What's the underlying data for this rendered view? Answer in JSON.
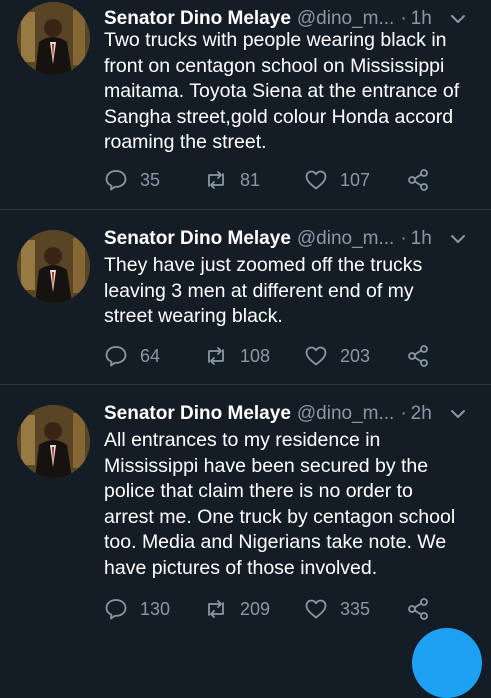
{
  "tweets": [
    {
      "name": "Senator Dino Melaye",
      "handle": "@dino_m...",
      "time": "1h",
      "text": "Two trucks with people wearing black in\nfront on centagon school on Mississippi\nmaitama. Toyota Siena at the entrance of\nSangha street,gold colour Honda accord\nroaming the street.",
      "replies": "35",
      "retweets": "81",
      "likes": "107"
    },
    {
      "name": "Senator Dino Melaye",
      "handle": "@dino_m...",
      "time": "1h",
      "text": "They have just zoomed off the trucks\nleaving 3 men at different end of my\nstreet wearing black.",
      "replies": "64",
      "retweets": "108",
      "likes": "203"
    },
    {
      "name": "Senator Dino Melaye",
      "handle": "@dino_m...",
      "time": "2h",
      "text": "All entrances to my residence in\nMississippi have been secured by the\npolice that claim there is no order to\narrest me. One truck by centagon school\ntoo. Media and Nigerians take note. We\nhave pictures of those involved.",
      "replies": "130",
      "retweets": "209",
      "likes": "335"
    }
  ],
  "separator": "·",
  "icons": {
    "reply": "reply-icon",
    "retweet": "retweet-icon",
    "like": "heart-icon",
    "share": "share-icon",
    "menu": "chevron-down-icon"
  },
  "colors": {
    "background": "#141d26",
    "muted": "#8899a6",
    "accent": "#1da1f2"
  }
}
